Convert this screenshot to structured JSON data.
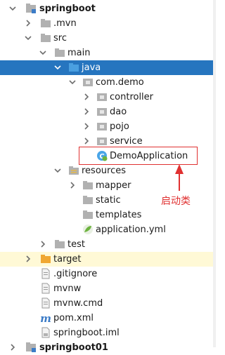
{
  "tree": {
    "items": [
      {
        "label": "springboot",
        "bold": true,
        "icon": "module-icon"
      },
      {
        "label": ".mvn",
        "icon": "folder-icon"
      },
      {
        "label": "src",
        "icon": "folder-icon"
      },
      {
        "label": "main",
        "icon": "folder-icon"
      },
      {
        "label": "java",
        "icon": "source-folder-icon"
      },
      {
        "label": "com.demo",
        "icon": "package-icon"
      },
      {
        "label": "controller",
        "icon": "package-icon"
      },
      {
        "label": "dao",
        "icon": "package-icon"
      },
      {
        "label": "pojo",
        "icon": "package-icon"
      },
      {
        "label": "service",
        "icon": "package-icon"
      },
      {
        "label": "DemoApplication",
        "icon": "spring-boot-class-icon"
      },
      {
        "label": "resources",
        "icon": "resources-folder-icon"
      },
      {
        "label": "mapper",
        "icon": "folder-icon"
      },
      {
        "label": "static",
        "icon": "folder-icon"
      },
      {
        "label": "templates",
        "icon": "folder-icon"
      },
      {
        "label": "application.yml",
        "icon": "spring-config-icon"
      },
      {
        "label": "test",
        "icon": "folder-icon"
      },
      {
        "label": "target",
        "icon": "excluded-folder-icon"
      },
      {
        "label": ".gitignore",
        "icon": "file-icon"
      },
      {
        "label": "mvnw",
        "icon": "file-icon"
      },
      {
        "label": "mvnw.cmd",
        "icon": "file-icon"
      },
      {
        "label": "pom.xml",
        "icon": "maven-icon"
      },
      {
        "label": "springboot.iml",
        "icon": "iml-file-icon"
      },
      {
        "label": "springboot01",
        "bold": true,
        "icon": "module-icon"
      }
    ]
  },
  "annotation": {
    "label": "启动类"
  },
  "colors": {
    "selection": "#2675bf",
    "folder": "#b1b1b1",
    "source_folder": "#4a9fe0",
    "target_folder": "#f0a732",
    "annotation": "#e03131"
  }
}
